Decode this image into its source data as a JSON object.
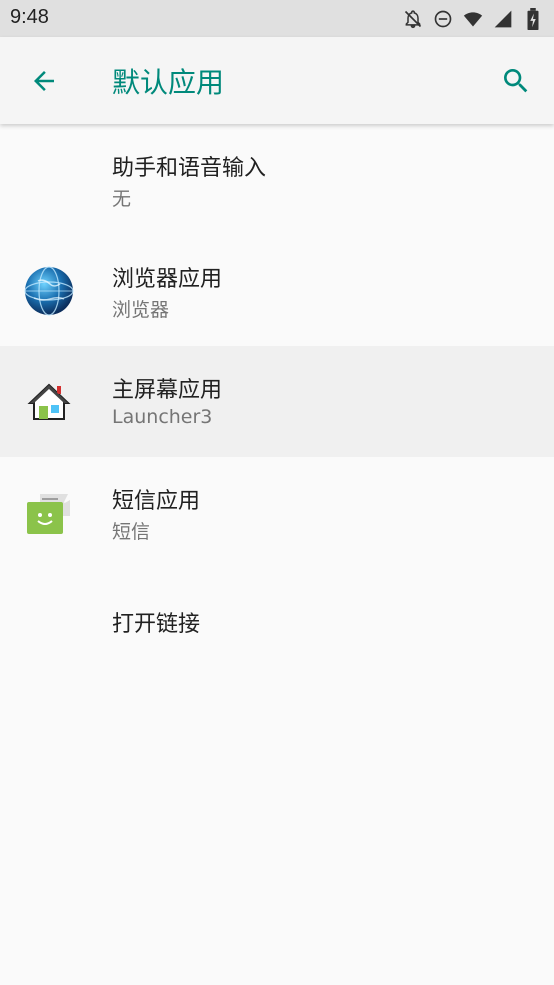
{
  "status_bar": {
    "time": "9:48",
    "icons": [
      "notifications-off-icon",
      "do-not-disturb-icon",
      "wifi-icon",
      "signal-icon",
      "battery-charging-icon"
    ]
  },
  "app_bar": {
    "title": "默认应用",
    "back_icon": "back-arrow-icon",
    "search_icon": "search-icon",
    "accent_color": "#00897b"
  },
  "items": [
    {
      "title": "助手和语音输入",
      "subtitle": "无",
      "icon": "none"
    },
    {
      "title": "浏览器应用",
      "subtitle": "浏览器",
      "icon": "globe-icon"
    },
    {
      "title": "主屏幕应用",
      "subtitle": "Launcher3",
      "icon": "home-launcher-icon"
    },
    {
      "title": "短信应用",
      "subtitle": "短信",
      "icon": "messaging-icon"
    },
    {
      "title": "打开链接",
      "subtitle": "",
      "icon": "none"
    }
  ]
}
